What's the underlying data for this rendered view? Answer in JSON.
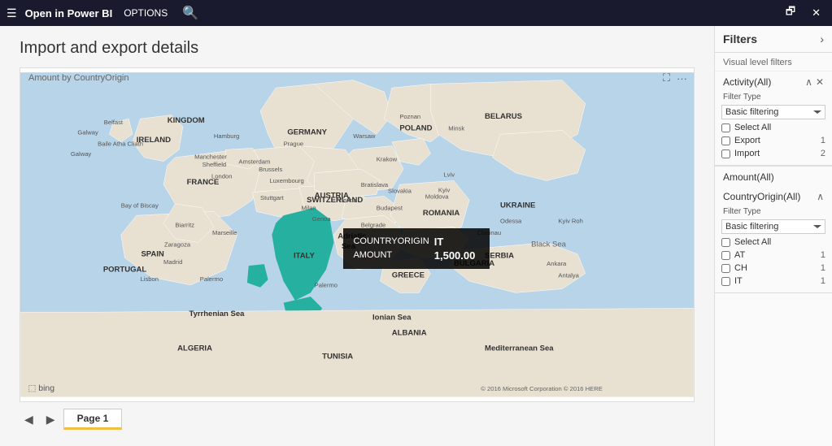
{
  "titleBar": {
    "appName": "Open in Power BI",
    "options": "OPTIONS",
    "searchIcon": "🔍",
    "controls": [
      "🗗",
      "✕"
    ]
  },
  "report": {
    "title": "Import and export details",
    "mapLabel": "Amount by CountryOrigin",
    "pageNav": {
      "prevLabel": "<",
      "nextLabel": ">",
      "pages": [
        {
          "label": "Page 1",
          "active": true
        }
      ]
    },
    "bingLogo": "⬚ bing",
    "copyright": "© 2016 Microsoft Corporation  © 2016 HERE",
    "tooltip": {
      "countryOriginLabel": "COUNTRYORIGIN",
      "countryOriginValue": "IT",
      "amountLabel": "AMOUNT",
      "amountValue": "1,500.00"
    }
  },
  "filters": {
    "title": "Filters",
    "collapseIcon": "›",
    "visualLevelLabel": "Visual level filters",
    "blocks": [
      {
        "id": "activity",
        "title": "Activity(All)",
        "collapseIcon": "∧",
        "closeIcon": "✕",
        "filterTypeLabel": "Filter Type",
        "filterTypeValue": "Basic filtering",
        "options": [
          {
            "label": "Select All",
            "count": "",
            "checked": false
          },
          {
            "label": "Export",
            "count": "1",
            "checked": false
          },
          {
            "label": "Import",
            "count": "2",
            "checked": false
          }
        ]
      }
    ],
    "amountSection": {
      "title": "Amount(All)",
      "collapseIcon": ""
    },
    "countryOriginSection": {
      "title": "CountryOrigin(All)",
      "collapseIcon": "∧",
      "filterTypeLabel": "Filter Type",
      "filterTypeValue": "Basic filtering",
      "options": [
        {
          "label": "Select All",
          "count": "",
          "checked": false
        },
        {
          "label": "AT",
          "count": "1",
          "checked": false
        },
        {
          "label": "CH",
          "count": "1",
          "checked": false
        },
        {
          "label": "IT",
          "count": "1",
          "checked": false
        }
      ]
    }
  }
}
